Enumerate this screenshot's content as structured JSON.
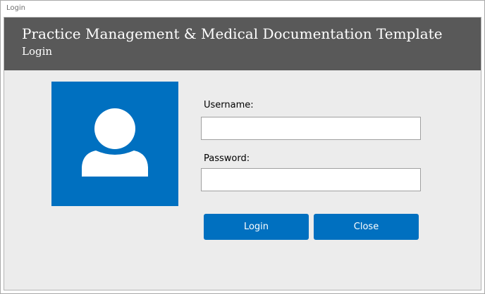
{
  "window": {
    "title": "Login"
  },
  "header": {
    "title": "Practice Management & Medical Documentation Template",
    "subtitle": "Login"
  },
  "avatar": {
    "icon": "user-silhouette-icon",
    "background_color": "#0070c0"
  },
  "form": {
    "username_label": "Username:",
    "username_value": "",
    "password_label": "Password:",
    "password_value": ""
  },
  "buttons": {
    "login_label": "Login",
    "close_label": "Close"
  },
  "colors": {
    "accent": "#0070c0",
    "header_bg": "#595959",
    "form_bg": "#ececec"
  }
}
